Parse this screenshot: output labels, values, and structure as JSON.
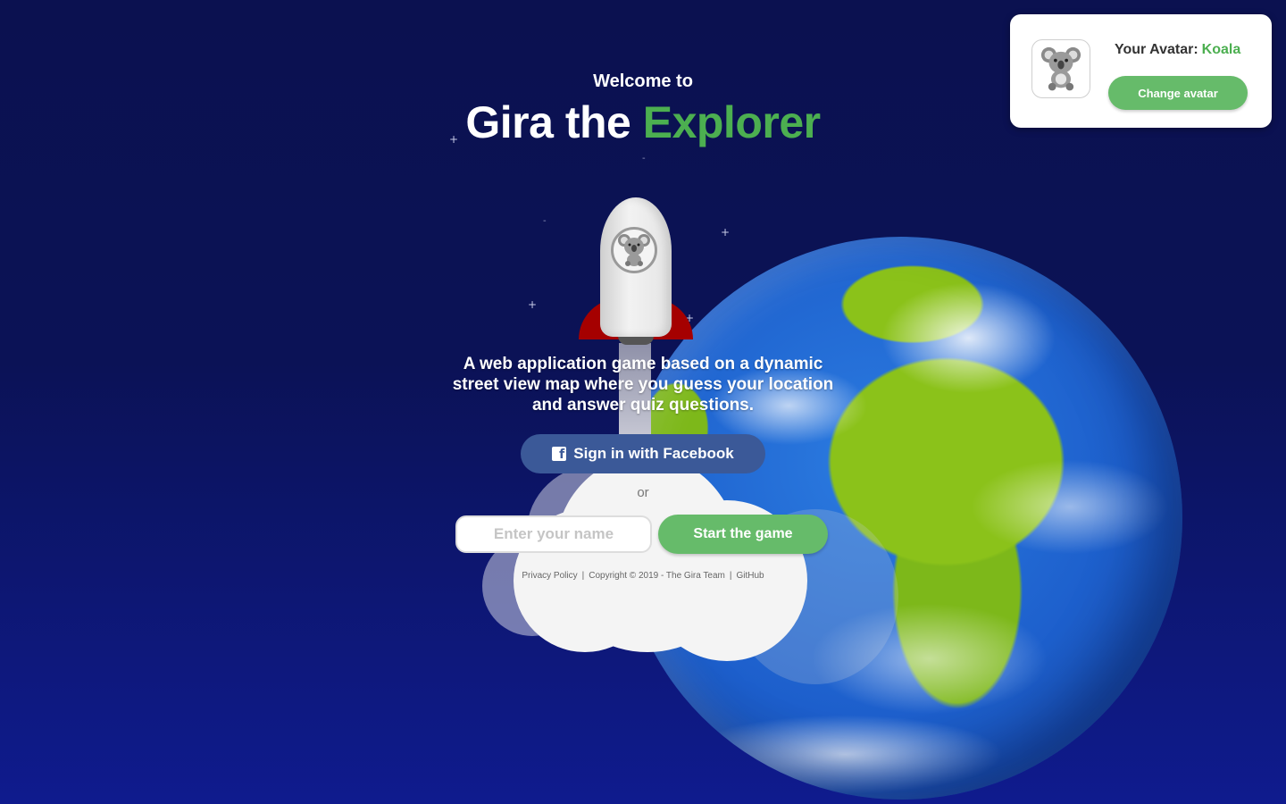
{
  "header": {
    "welcome": "Welcome to",
    "title_main": "Gira the ",
    "title_accent": "Explorer"
  },
  "avatar_card": {
    "label": "Your Avatar:",
    "avatar_name": "Koala",
    "avatar_icon": "koala-icon",
    "change_button": "Change avatar"
  },
  "tagline": "A web application game based on a dynamic street view map where you guess your location and answer quiz questions.",
  "login": {
    "facebook_button": "Sign in with Facebook",
    "facebook_icon": "facebook-icon",
    "or": "or",
    "name_placeholder": "Enter your name",
    "start_button": "Start the game"
  },
  "footer": {
    "privacy": "Privacy Policy",
    "copyright": "Copyright © 2019 - The Gira Team",
    "github": "GitHub",
    "separator": "|"
  },
  "colors": {
    "accent_green": "#4caf50",
    "button_green": "#66bb6a",
    "facebook_blue": "#3b5998",
    "background_navy": "#0b1150",
    "rocket_fin_red": "#a50000"
  }
}
